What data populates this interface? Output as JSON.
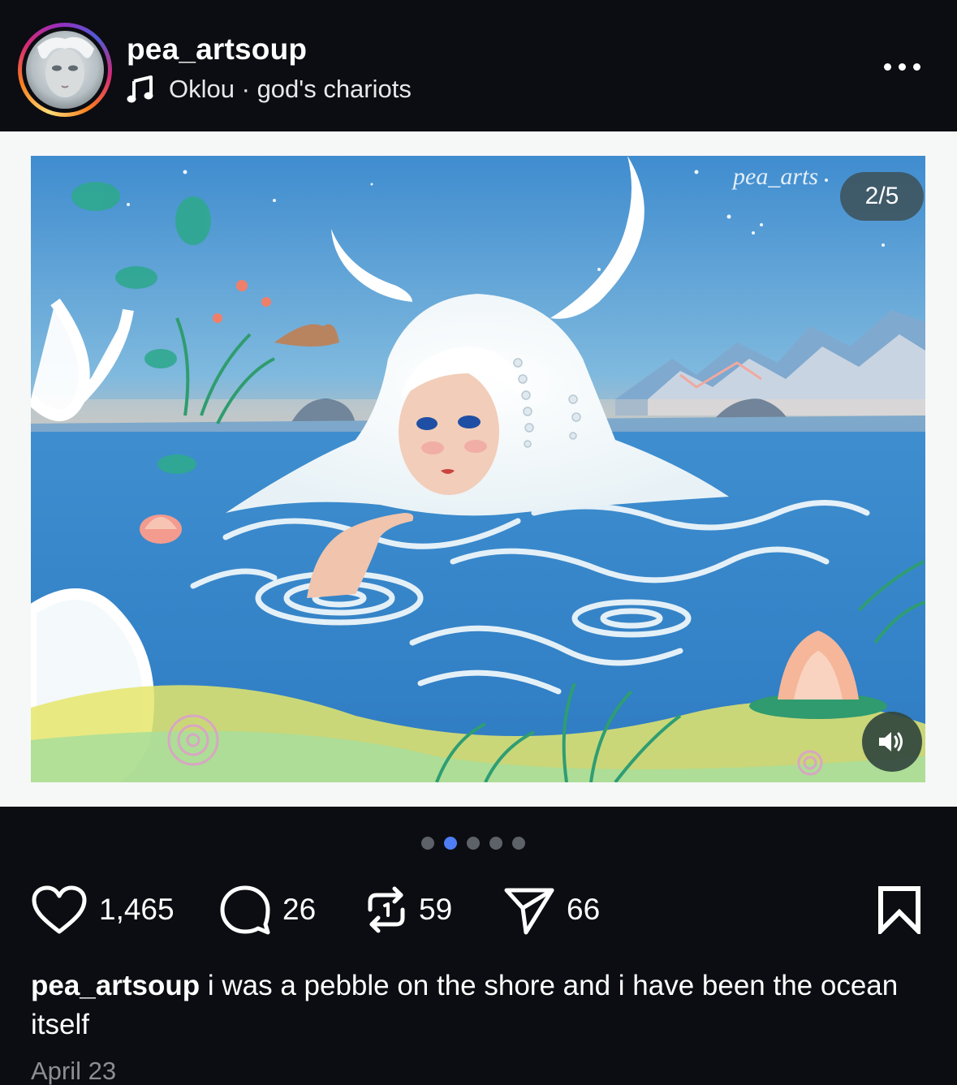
{
  "post": {
    "username": "pea_artsoup",
    "music": {
      "icon": "music-note-icon",
      "artist": "Oklou",
      "separator": "·",
      "track": "god's chariots"
    },
    "more_icon": "more-horizontal-icon"
  },
  "media": {
    "page_indicator": "2/5",
    "current_page": 2,
    "total_pages": 5,
    "watermark": "pea_arts",
    "audio_icon": "speaker-icon"
  },
  "carousel": {
    "count": 5,
    "active_index": 1,
    "active_color": "#4e7df5",
    "inactive_color": "#5d6168"
  },
  "actions": {
    "likes": "1,465",
    "comments": "26",
    "reposts": "59",
    "shares": "66",
    "icons": [
      "heart-icon",
      "comment-icon",
      "repost-icon",
      "share-icon",
      "bookmark-icon"
    ]
  },
  "caption": {
    "username": "pea_artsoup",
    "text": "i was a pebble on the shore and i have been the ocean itself"
  },
  "date": "April 23",
  "colors": {
    "background": "#0c0d12",
    "media_frame": "#f6f8f7",
    "text_primary": "#ffffff",
    "text_secondary": "#8b8e95"
  }
}
